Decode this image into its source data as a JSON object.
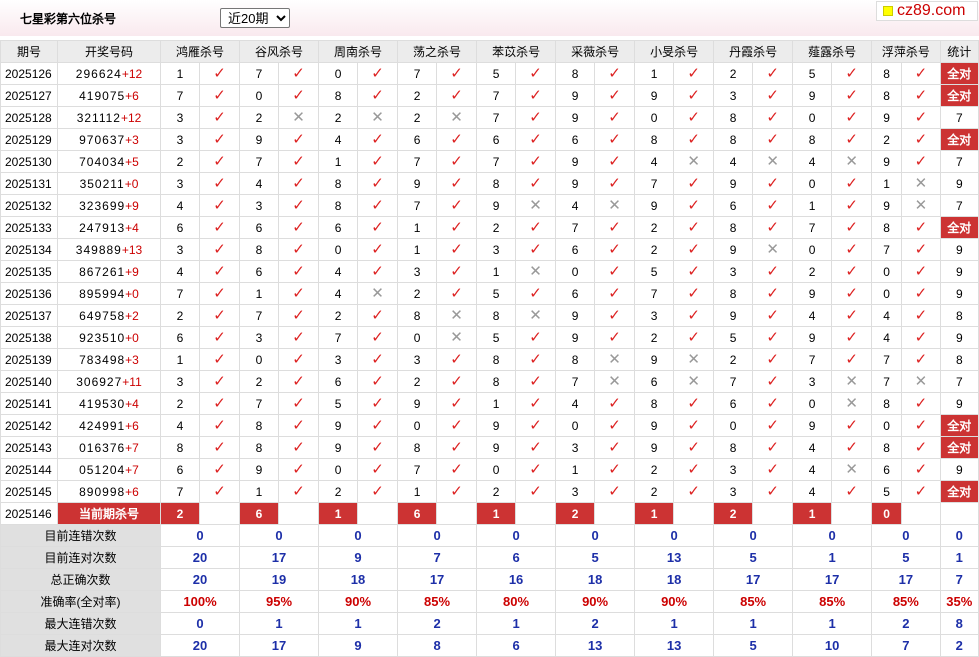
{
  "header": {
    "title": "七星彩第六位杀号",
    "select_value": "近20期",
    "brand": "cz89.com"
  },
  "columns": {
    "qihao": "期号",
    "kaijiang": "开奖号码",
    "experts": [
      "鸿雁杀号",
      "谷风杀号",
      "周南杀号",
      "荡之杀号",
      "苯苡杀号",
      "采薇杀号",
      "小旻杀号",
      "丹霞杀号",
      "薤露杀号",
      "浮萍杀号"
    ],
    "stat": "统计"
  },
  "marks": {
    "ok": "✓",
    "no": "✕"
  },
  "rows": [
    {
      "qh": "2025126",
      "num": "296624",
      "plus": "+12",
      "k": [
        1,
        7,
        0,
        7,
        5,
        8,
        1,
        2,
        5,
        8
      ],
      "r": "1111111111",
      "stat": "全对"
    },
    {
      "qh": "2025127",
      "num": "419075",
      "plus": "+6",
      "k": [
        7,
        0,
        8,
        2,
        7,
        9,
        9,
        3,
        9,
        8
      ],
      "r": "1111111111",
      "stat": "全对"
    },
    {
      "qh": "2025128",
      "num": "321112",
      "plus": "+12",
      "k": [
        3,
        2,
        2,
        2,
        7,
        9,
        0,
        8,
        0,
        9
      ],
      "r": "1000111111",
      "stat": "7"
    },
    {
      "qh": "2025129",
      "num": "970637",
      "plus": "+3",
      "k": [
        3,
        9,
        4,
        6,
        6,
        6,
        8,
        8,
        8,
        2
      ],
      "r": "1111111111",
      "stat": "全对"
    },
    {
      "qh": "2025130",
      "num": "704034",
      "plus": "+5",
      "k": [
        2,
        7,
        1,
        7,
        7,
        9,
        4,
        4,
        4,
        9
      ],
      "r": "1111110001",
      "stat": "7"
    },
    {
      "qh": "2025131",
      "num": "350211",
      "plus": "+0",
      "k": [
        3,
        4,
        8,
        9,
        8,
        9,
        7,
        9,
        0,
        1
      ],
      "r": "1111111110",
      "stat": "9"
    },
    {
      "qh": "2025132",
      "num": "323699",
      "plus": "+9",
      "k": [
        4,
        3,
        8,
        7,
        9,
        4,
        9,
        6,
        1,
        9
      ],
      "r": "1111001110",
      "stat": "7"
    },
    {
      "qh": "2025133",
      "num": "247913",
      "plus": "+4",
      "k": [
        6,
        6,
        6,
        1,
        2,
        7,
        2,
        8,
        7,
        8
      ],
      "r": "1111111111",
      "stat": "全对"
    },
    {
      "qh": "2025134",
      "num": "349889",
      "plus": "+13",
      "k": [
        3,
        8,
        0,
        1,
        3,
        6,
        2,
        9,
        0,
        7
      ],
      "r": "1111111011",
      "stat": "9"
    },
    {
      "qh": "2025135",
      "num": "867261",
      "plus": "+9",
      "k": [
        4,
        6,
        4,
        3,
        1,
        0,
        5,
        3,
        2,
        0
      ],
      "r": "1111011111",
      "stat": "9"
    },
    {
      "qh": "2025136",
      "num": "895994",
      "plus": "+0",
      "k": [
        7,
        1,
        4,
        2,
        5,
        6,
        7,
        8,
        9,
        0
      ],
      "r": "1101111111",
      "stat": "9"
    },
    {
      "qh": "2025137",
      "num": "649758",
      "plus": "+2",
      "k": [
        2,
        7,
        2,
        8,
        8,
        9,
        3,
        9,
        4,
        4
      ],
      "r": "1110011111",
      "stat": "8"
    },
    {
      "qh": "2025138",
      "num": "923510",
      "plus": "+0",
      "k": [
        6,
        3,
        7,
        0,
        5,
        9,
        2,
        5,
        9,
        4
      ],
      "r": "1110111111",
      "stat": "9"
    },
    {
      "qh": "2025139",
      "num": "783498",
      "plus": "+3",
      "k": [
        1,
        0,
        3,
        3,
        8,
        8,
        9,
        2,
        7,
        7
      ],
      "r": "1111100111",
      "stat": "8"
    },
    {
      "qh": "2025140",
      "num": "306927",
      "plus": "+11",
      "k": [
        3,
        2,
        6,
        2,
        8,
        7,
        6,
        7,
        3,
        7
      ],
      "r": "1111100100",
      "stat": "7"
    },
    {
      "qh": "2025141",
      "num": "419530",
      "plus": "+4",
      "k": [
        2,
        7,
        5,
        9,
        1,
        4,
        8,
        6,
        0,
        8
      ],
      "r": "1111111101",
      "stat": "9"
    },
    {
      "qh": "2025142",
      "num": "424991",
      "plus": "+6",
      "k": [
        4,
        8,
        9,
        0,
        9,
        0,
        9,
        0,
        9,
        0
      ],
      "r": "1111111111",
      "stat": "全对"
    },
    {
      "qh": "2025143",
      "num": "016376",
      "plus": "+7",
      "k": [
        8,
        8,
        9,
        8,
        9,
        3,
        9,
        8,
        4,
        8
      ],
      "r": "1111111111",
      "stat": "全对"
    },
    {
      "qh": "2025144",
      "num": "051204",
      "plus": "+7",
      "k": [
        6,
        9,
        0,
        7,
        0,
        1,
        2,
        3,
        4,
        6
      ],
      "r": "1111111101",
      "stat": "9"
    },
    {
      "qh": "2025145",
      "num": "890998",
      "plus": "+6",
      "k": [
        7,
        1,
        2,
        1,
        2,
        3,
        2,
        3,
        4,
        5
      ],
      "r": "1111111111",
      "stat": "全对"
    }
  ],
  "current": {
    "qh": "2025146",
    "label": "当前期杀号",
    "values": [
      "2",
      "6",
      "1",
      "6",
      "1",
      "2",
      "1",
      "2",
      "1",
      "0"
    ]
  },
  "stats": [
    {
      "label": "目前连错次数",
      "cls": "sv",
      "values": [
        "0",
        "0",
        "0",
        "0",
        "0",
        "0",
        "0",
        "0",
        "0",
        "0"
      ],
      "total": "0"
    },
    {
      "label": "目前连对次数",
      "cls": "sv",
      "values": [
        "20",
        "17",
        "9",
        "7",
        "6",
        "5",
        "13",
        "5",
        "1",
        "5"
      ],
      "total": "1"
    },
    {
      "label": "总正确次数",
      "cls": "sv",
      "values": [
        "20",
        "19",
        "18",
        "17",
        "16",
        "18",
        "18",
        "17",
        "17",
        "17"
      ],
      "total": "7"
    },
    {
      "label": "准确率(全对率)",
      "cls": "sr",
      "values": [
        "100%",
        "95%",
        "90%",
        "85%",
        "80%",
        "90%",
        "90%",
        "85%",
        "85%",
        "85%"
      ],
      "total": "35%"
    },
    {
      "label": "最大连错次数",
      "cls": "sv",
      "values": [
        "0",
        "1",
        "1",
        "2",
        "1",
        "2",
        "1",
        "1",
        "1",
        "2"
      ],
      "total": "8"
    },
    {
      "label": "最大连对次数",
      "cls": "sv",
      "values": [
        "20",
        "17",
        "9",
        "8",
        "6",
        "13",
        "13",
        "5",
        "10",
        "7"
      ],
      "total": "2"
    }
  ]
}
